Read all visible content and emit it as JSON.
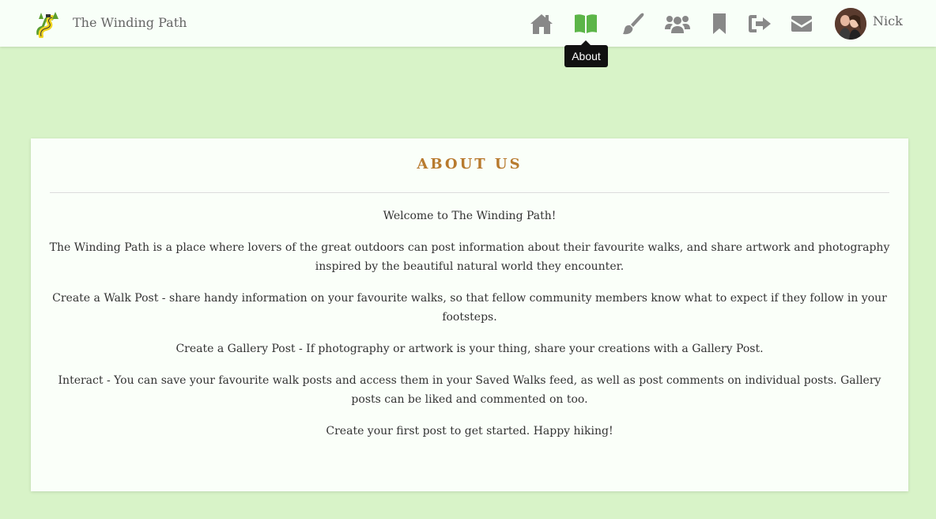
{
  "header": {
    "site_title": "The Winding Path",
    "username": "Nick",
    "tooltip": "About",
    "nav": [
      {
        "name": "home-icon",
        "label": "Home"
      },
      {
        "name": "book-icon",
        "label": "About",
        "active_color": "#5cb548"
      },
      {
        "name": "paintbrush-icon",
        "label": "Gallery"
      },
      {
        "name": "users-icon",
        "label": "Community"
      },
      {
        "name": "bookmark-icon",
        "label": "Saved Walks"
      },
      {
        "name": "sign-out-icon",
        "label": "Sign Out"
      },
      {
        "name": "envelope-icon",
        "label": "Contact"
      }
    ],
    "icon_color": "#888888"
  },
  "main": {
    "title": "ABOUT US",
    "paragraphs": [
      "Welcome to The Winding Path!",
      "The Winding Path is a place where lovers of the great outdoors can post information about their favourite walks, and share artwork and photography inspired by the beautiful natural world they encounter.",
      "Create a Walk Post - share handy information on your favourite walks, so that fellow community members know what to expect if they follow in your footsteps.",
      "Create a Gallery Post - If photography or artwork is your thing, share your creations with a Gallery Post.",
      "Interact - You can save your favourite walk posts and access them in your Saved Walks feed, as well as post comments on individual posts. Gallery posts can be liked and commented on too.",
      "Create your first post to get started. Happy hiking!"
    ]
  },
  "colors": {
    "page_background": "#d8f3c8",
    "accent": "#b87a2e",
    "active_nav": "#5cb548"
  }
}
